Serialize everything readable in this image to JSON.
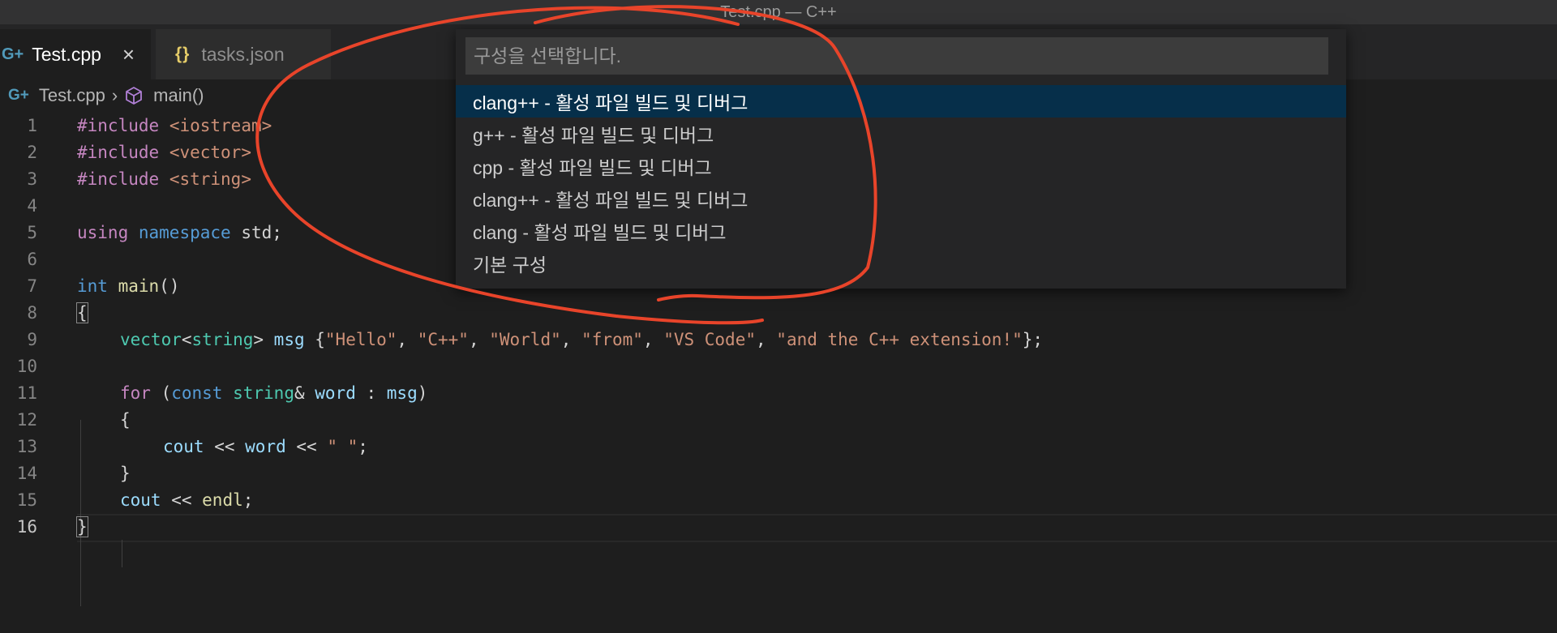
{
  "window": {
    "title": "Test.cpp — C++"
  },
  "tabs": [
    {
      "label": "Test.cpp",
      "icon": "cpp-file-icon",
      "active": true
    },
    {
      "label": "tasks.json",
      "icon": "json-file-icon",
      "active": false
    }
  ],
  "breadcrumb": {
    "file": "Test.cpp",
    "symbol": "main()"
  },
  "quick_pick": {
    "placeholder": "구성을 선택합니다.",
    "items": [
      {
        "label": "clang++ - 활성 파일 빌드 및 디버그",
        "selected": true
      },
      {
        "label": "g++ - 활성 파일 빌드 및 디버그"
      },
      {
        "label": "cpp - 활성 파일 빌드 및 디버그"
      },
      {
        "label": "clang++ - 활성 파일 빌드 및 디버그"
      },
      {
        "label": "clang - 활성 파일 빌드 및 디버그"
      },
      {
        "label": "기본 구성"
      }
    ]
  },
  "editor": {
    "line_numbers": [
      "1",
      "2",
      "3",
      "4",
      "5",
      "6",
      "7",
      "8",
      "9",
      "10",
      "11",
      "12",
      "13",
      "14",
      "15",
      "16"
    ],
    "tokens": {
      "l1": [
        "#include",
        " ",
        "<iostream>"
      ],
      "l2": [
        "#include",
        " ",
        "<vector>"
      ],
      "l3": [
        "#include",
        " ",
        "<string>"
      ],
      "l5": [
        "using",
        " ",
        "namespace",
        " std;"
      ],
      "l7": [
        "int",
        " ",
        "main",
        "()"
      ],
      "l8": [
        "{"
      ],
      "l9": [
        "vector",
        "<",
        "string",
        "> ",
        "msg",
        " {",
        "\"Hello\"",
        ", ",
        "\"C++\"",
        ", ",
        "\"World\"",
        ", ",
        "\"from\"",
        ", ",
        "\"VS Code\"",
        ", ",
        "\"and the C++ extension!\"",
        "};"
      ],
      "l11": [
        "for",
        " (",
        "const",
        " ",
        "string",
        "& ",
        "word",
        " : ",
        "msg",
        ")"
      ],
      "l12": [
        "{"
      ],
      "l13": [
        "cout",
        " << ",
        "word",
        " << ",
        "\" \"",
        ";"
      ],
      "l14": [
        "}"
      ],
      "l15": [
        "cout",
        " << ",
        "endl",
        ";"
      ],
      "l16": [
        "}"
      ]
    }
  },
  "colors": {
    "background": "#1e1e1e",
    "selection": "#062f4a",
    "annotation": "#e8442a",
    "keyword": "#c586c0",
    "storage": "#569cd6",
    "string": "#ce9178",
    "type": "#4ec9b0",
    "function": "#dcdcaa",
    "variable": "#9cdcfe"
  }
}
